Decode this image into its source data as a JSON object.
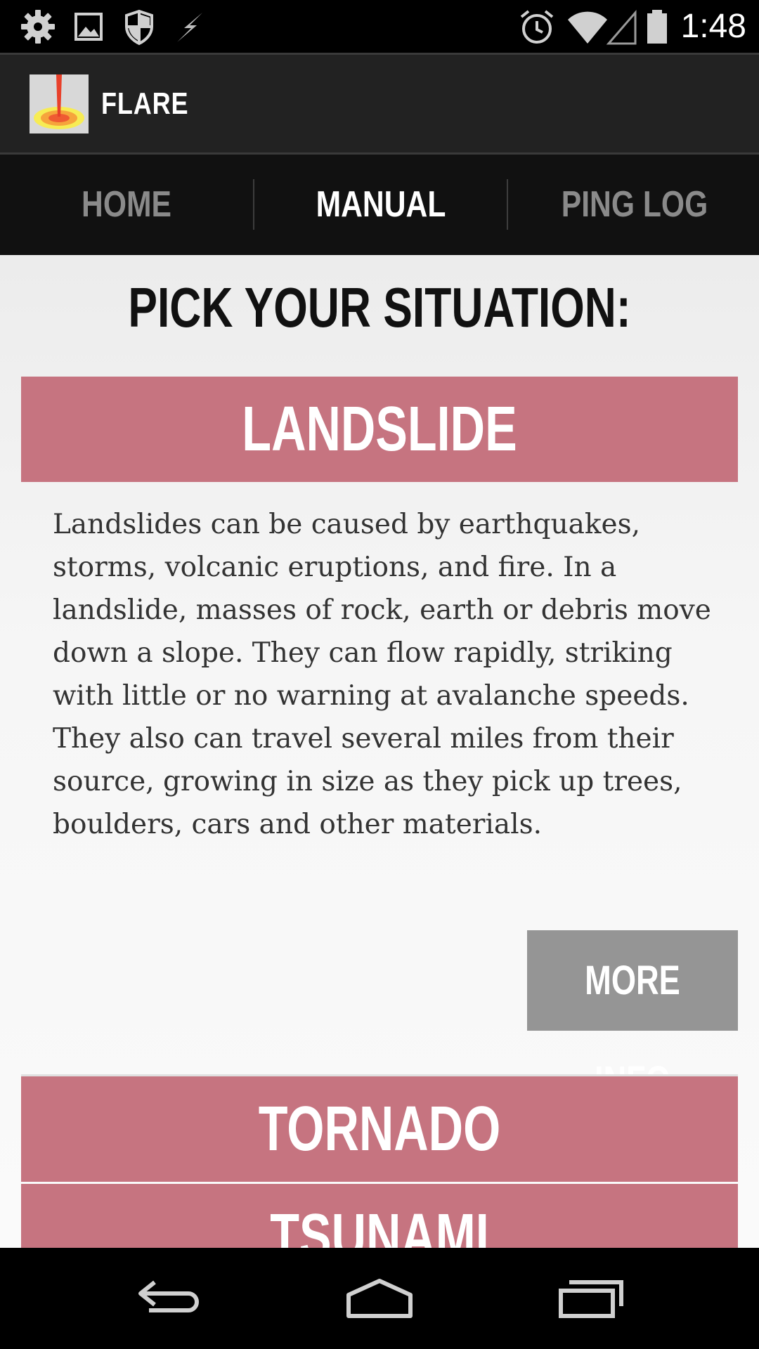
{
  "status_bar": {
    "time": "1:48",
    "left_icons": [
      "settings-icon",
      "image-icon",
      "shield-icon",
      "flash-icon"
    ],
    "right_icons": [
      "alarm-icon",
      "wifi-icon",
      "signal-icon",
      "battery-icon"
    ]
  },
  "app": {
    "title": "FLARE",
    "logo_icon": "flare-logo-icon"
  },
  "tabs": [
    {
      "label": "HOME",
      "active": false
    },
    {
      "label": "MANUAL",
      "active": true
    },
    {
      "label": "PING LOG",
      "active": false
    }
  ],
  "colors": {
    "accent": "#33b5e5",
    "situation_header": "#c67480",
    "more_info_button": "#959595"
  },
  "main": {
    "heading": "PICK YOUR SITUATION:",
    "situations": [
      {
        "label": "LANDSLIDE",
        "expanded": true,
        "description": "Landslides can be caused by earthquakes, storms, volcanic eruptions, and fire. In a landslide, masses of rock, earth or debris move down a slope. They can flow rapidly, striking with little or no warning at avalanche speeds. They also can travel several miles from their source, growing in size as they pick up trees, boulders, cars and other materials.",
        "button_label": "MORE INFO"
      },
      {
        "label": "TORNADO",
        "expanded": false
      },
      {
        "label": "TSUNAMI",
        "expanded": false
      }
    ]
  },
  "nav_bar": {
    "buttons": [
      "back-icon",
      "home-icon",
      "recent-apps-icon"
    ]
  }
}
